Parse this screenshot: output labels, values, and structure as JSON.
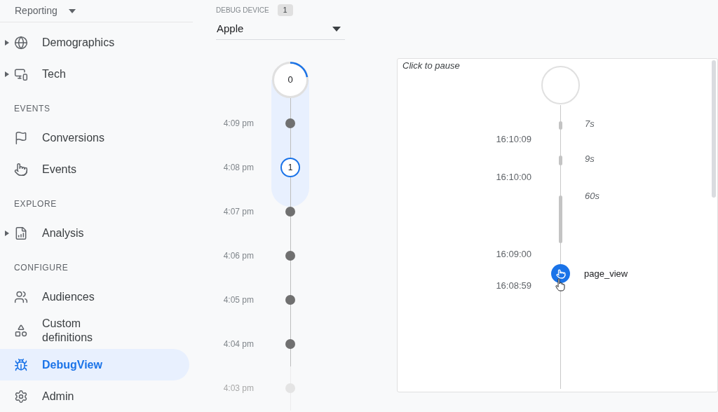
{
  "sidebar": {
    "property_menu": {
      "label": "Reporting"
    },
    "sections": [
      {
        "items": [
          {
            "label": "Demographics",
            "expandable": true,
            "selected": false
          },
          {
            "label": "Tech",
            "expandable": true,
            "selected": false
          }
        ]
      },
      {
        "heading": "EVENTS",
        "items": [
          {
            "label": "Conversions",
            "expandable": false,
            "selected": false
          },
          {
            "label": "Events",
            "expandable": false,
            "selected": false
          }
        ]
      },
      {
        "heading": "EXPLORE",
        "items": [
          {
            "label": "Analysis",
            "expandable": true,
            "selected": false
          }
        ]
      },
      {
        "heading": "CONFIGURE",
        "items": [
          {
            "label": "Audiences",
            "expandable": false,
            "selected": false
          },
          {
            "label": "Custom definitions",
            "expandable": false,
            "selected": false
          },
          {
            "label": "DebugView",
            "expandable": false,
            "selected": true
          },
          {
            "label": "Admin",
            "expandable": false,
            "selected": false
          }
        ]
      }
    ]
  },
  "device": {
    "label": "DEBUG DEVICE",
    "count": "1",
    "value": "Apple"
  },
  "minutes": [
    {
      "kind": "count",
      "count": "0",
      "highlighted": true,
      "faded": false
    },
    {
      "time": "4:09 pm",
      "kind": "dot",
      "highlighted": true,
      "faded": false
    },
    {
      "time": "4:08 pm",
      "kind": "ring",
      "count": "1",
      "highlighted": true,
      "faded": false
    },
    {
      "time": "4:07 pm",
      "kind": "dot",
      "highlighted": false,
      "faded": false
    },
    {
      "time": "4:06 pm",
      "kind": "dot",
      "highlighted": false,
      "faded": false
    },
    {
      "time": "4:05 pm",
      "kind": "dot",
      "highlighted": false,
      "faded": false
    },
    {
      "time": "4:04 pm",
      "kind": "dot",
      "highlighted": false,
      "faded": false
    },
    {
      "time": "4:03 pm",
      "kind": "dot",
      "highlighted": false,
      "faded": true
    }
  ],
  "stream": {
    "hint": "Click to pause",
    "times": [
      "16:10:09",
      "16:10:00",
      "16:09:00",
      "16:08:59"
    ],
    "gaps": [
      "7s",
      "9s",
      "60s"
    ],
    "events": [
      {
        "name": "page_view"
      }
    ]
  }
}
